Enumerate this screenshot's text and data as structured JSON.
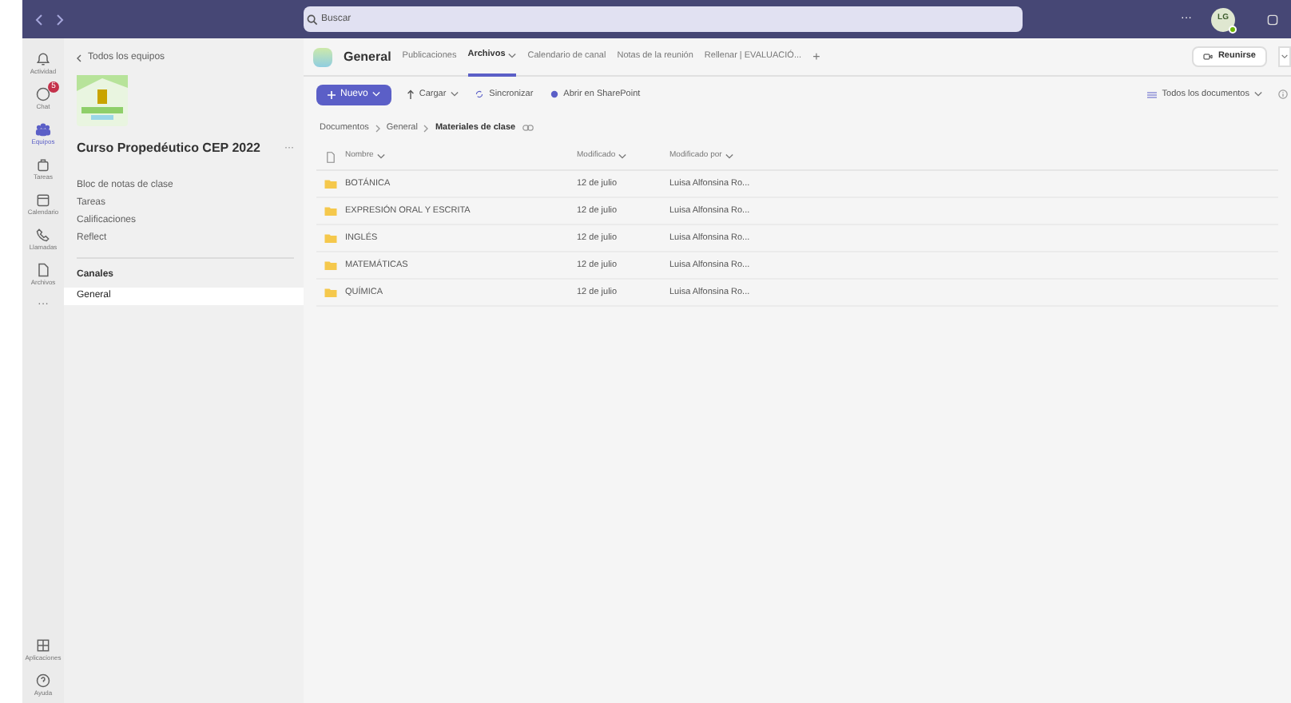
{
  "search": {
    "placeholder": "Buscar"
  },
  "top_bar": {
    "more": "···",
    "avatar": "LG"
  },
  "rail": {
    "items": [
      {
        "label": "Actividad",
        "selected": false
      },
      {
        "label": "Chat",
        "selected": false,
        "badge": "5"
      },
      {
        "label": "Equipos",
        "selected": true
      },
      {
        "label": "Tareas",
        "selected": false
      },
      {
        "label": "Calendario",
        "selected": false
      },
      {
        "label": "Llamadas",
        "selected": false
      },
      {
        "label": "Archivos",
        "selected": false
      }
    ],
    "more": "···",
    "bottom": [
      {
        "label": "Aplicaciones",
        "selected": false
      },
      {
        "label": "Ayuda",
        "selected": false
      }
    ]
  },
  "team_panel": {
    "back": "Todos los equipos",
    "team_name": "Curso Propedéutico CEP 2022",
    "more": "···",
    "items": [
      {
        "label": "Bloc de notas de clase",
        "selected": false
      },
      {
        "label": "Tareas",
        "selected": false
      },
      {
        "label": "Calificaciones",
        "selected": false
      },
      {
        "label": "Reflect",
        "selected": false
      }
    ],
    "channels_heading": "Canales",
    "channels": [
      {
        "label": "General",
        "selected": true
      }
    ]
  },
  "channel_header": {
    "name": "General",
    "tabs": [
      {
        "label": "Publicaciones",
        "selected": false,
        "dropdown": false
      },
      {
        "label": "Archivos",
        "selected": true,
        "dropdown": true
      },
      {
        "label": "Calendario de canal",
        "selected": false,
        "dropdown": false
      },
      {
        "label": "Notas de la reunión",
        "selected": false,
        "dropdown": false
      },
      {
        "label": "Rellenar | EVALUACIÓ...",
        "selected": false,
        "dropdown": false
      }
    ],
    "add": "+",
    "meet": "Reunirse"
  },
  "toolbar": {
    "new": "Nuevo",
    "upload": "Cargar",
    "sync": "Sincronizar",
    "sharepoint": "Abrir en SharePoint",
    "view": "Todos los documentos"
  },
  "breadcrumb": [
    "Documentos",
    "General",
    "Materiales de clase"
  ],
  "table": {
    "columns": [
      "Nombre",
      "Modificado",
      "Modificado por"
    ],
    "rows": [
      {
        "name": "BOTÁNICA",
        "modified": "12 de julio",
        "modified_by": "Luisa Alfonsina Ro..."
      },
      {
        "name": "EXPRESIÓN ORAL Y ESCRITA",
        "modified": "12 de julio",
        "modified_by": "Luisa Alfonsina Ro..."
      },
      {
        "name": "INGLÉS",
        "modified": "12 de julio",
        "modified_by": "Luisa Alfonsina Ro..."
      },
      {
        "name": "MATEMÁTICAS",
        "modified": "12 de julio",
        "modified_by": "Luisa Alfonsina Ro..."
      },
      {
        "name": "QUÍMICA",
        "modified": "12 de julio",
        "modified_by": "Luisa Alfonsina Ro..."
      }
    ]
  }
}
